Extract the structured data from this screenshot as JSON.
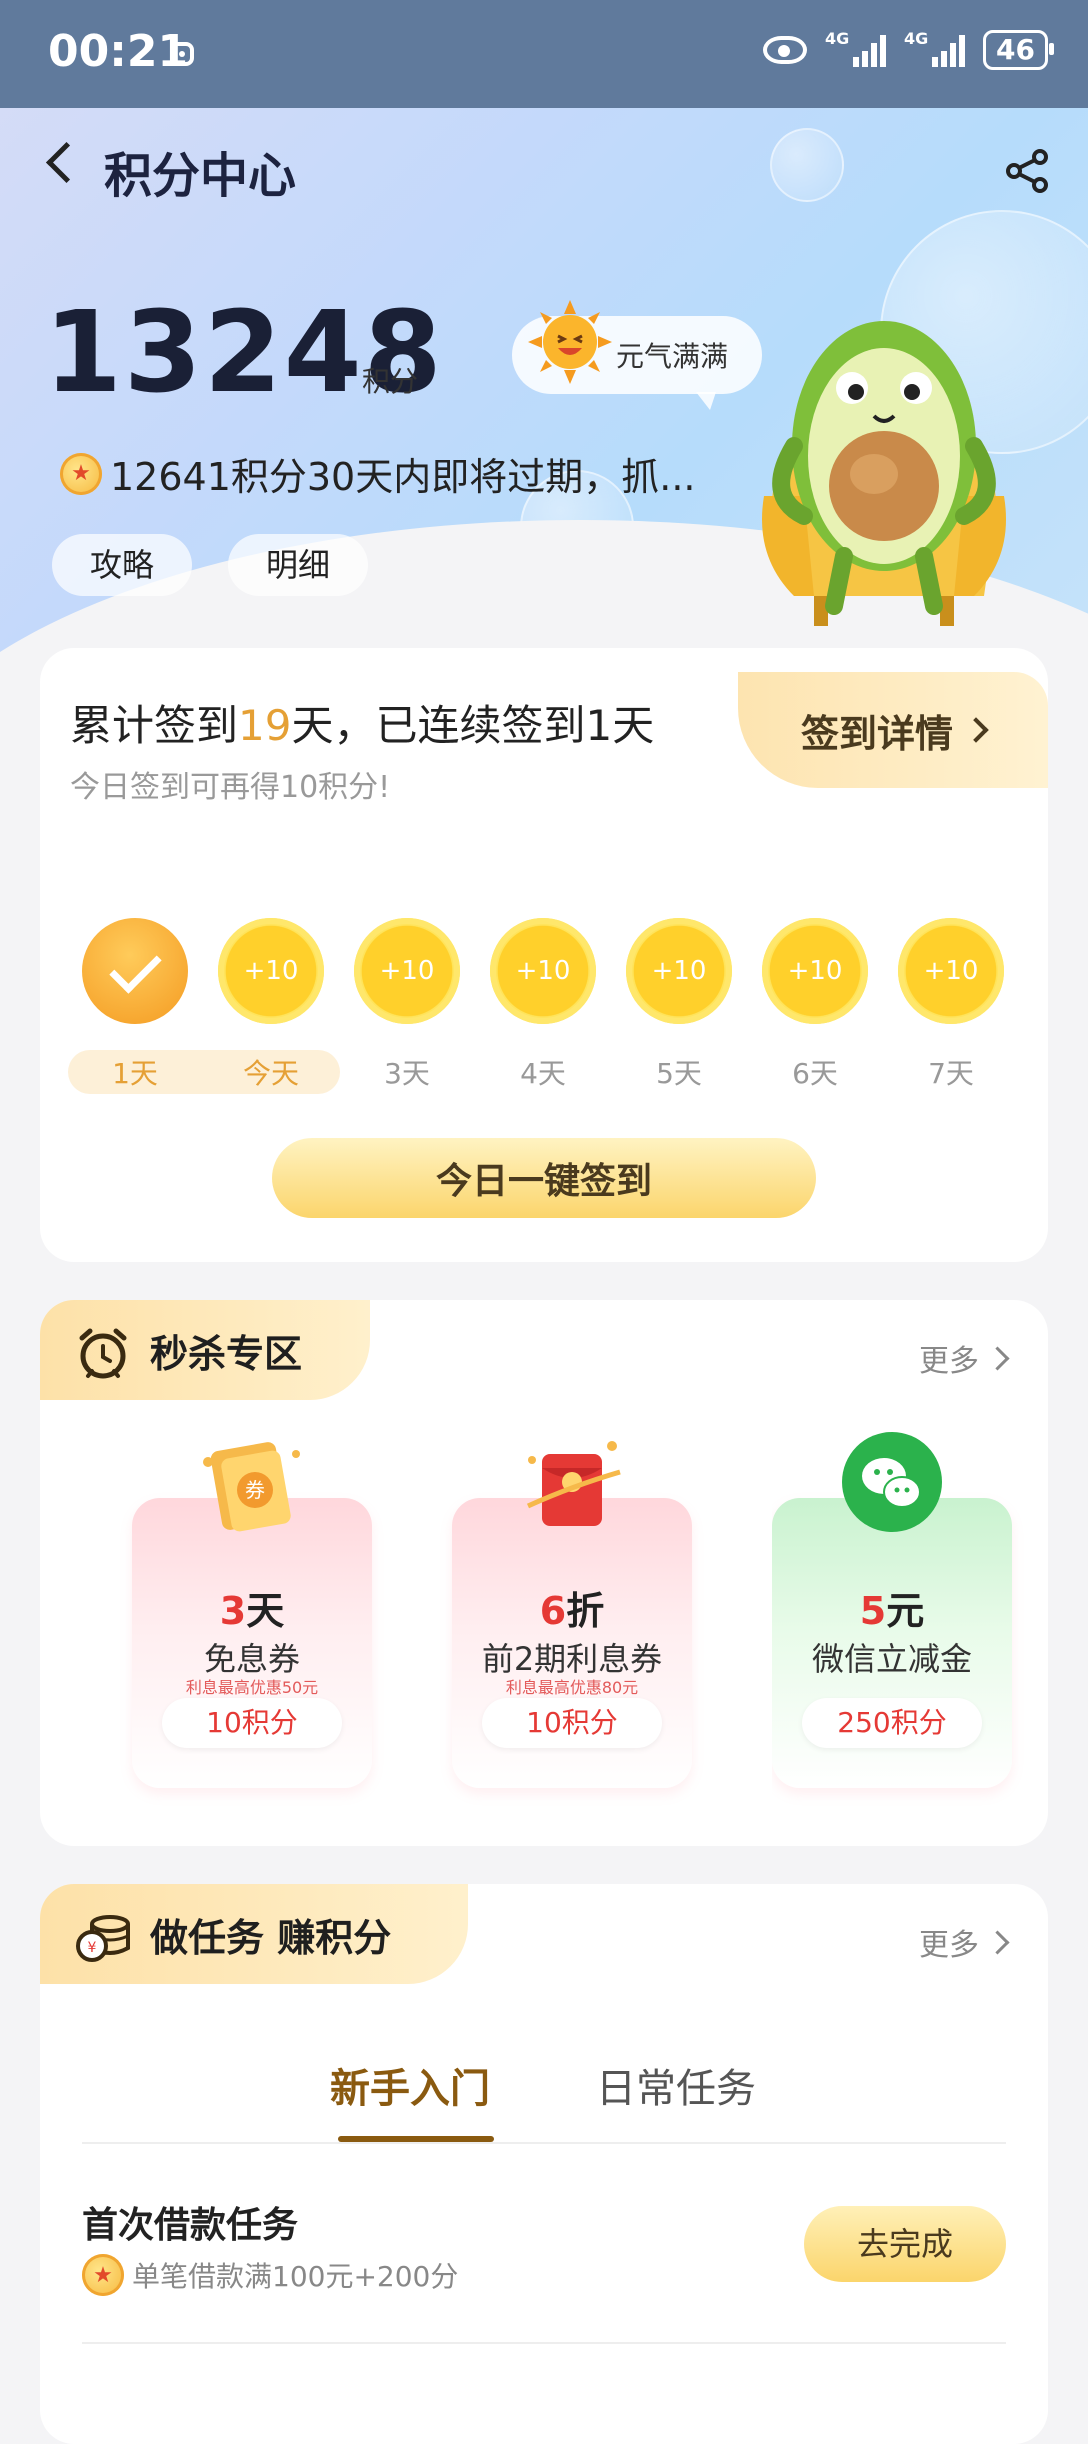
{
  "status_bar": {
    "time": "00:21",
    "net1": "4G",
    "net2": "4G",
    "battery": "46"
  },
  "header": {
    "title": "积分中心"
  },
  "points": {
    "value": "13248",
    "unit": "积分",
    "mood": "元气满满",
    "expire_notice": "12641积分30天内即将过期，抓..."
  },
  "pills": {
    "guide": "攻略",
    "detail": "明细"
  },
  "signin": {
    "title_prefix": "累计签到",
    "total_days": "19",
    "title_suffix": "天，已连续签到1天",
    "subtitle": "今日签到可再得10积分!",
    "detail_link": "签到详情",
    "days": [
      {
        "label": "1天",
        "reward": "",
        "done": true
      },
      {
        "label": "今天",
        "reward": "+10"
      },
      {
        "label": "3天",
        "reward": "+10"
      },
      {
        "label": "4天",
        "reward": "+10"
      },
      {
        "label": "5天",
        "reward": "+10"
      },
      {
        "label": "6天",
        "reward": "+10"
      },
      {
        "label": "7天",
        "reward": "+10"
      }
    ],
    "button": "今日一键签到"
  },
  "flash_sale": {
    "title": "秒杀专区",
    "more": "更多",
    "items": [
      {
        "num": "3",
        "unit": "天",
        "name": "免息券",
        "note": "利息最高优惠50元",
        "price": "10积分",
        "icon": "coupon-ticket-icon"
      },
      {
        "num": "6",
        "unit": "折",
        "name": "前2期利息券",
        "note": "利息最高优惠80元",
        "price": "10积分",
        "icon": "red-envelope-icon"
      },
      {
        "num": "5",
        "unit": "元",
        "name": "微信立减金",
        "note": "",
        "price": "250积分",
        "icon": "wechat-icon"
      }
    ]
  },
  "tasks": {
    "title": "做任务 赚积分",
    "more": "更多",
    "tabs": {
      "active": "新手入门",
      "inactive": "日常任务"
    },
    "items": [
      {
        "title": "首次借款任务",
        "desc": "单笔借款满100元+200分",
        "button": "去完成"
      }
    ]
  },
  "colors": {
    "accent": "#e5a035",
    "brand_gold": "#fbd56c",
    "price_red": "#e53935"
  }
}
